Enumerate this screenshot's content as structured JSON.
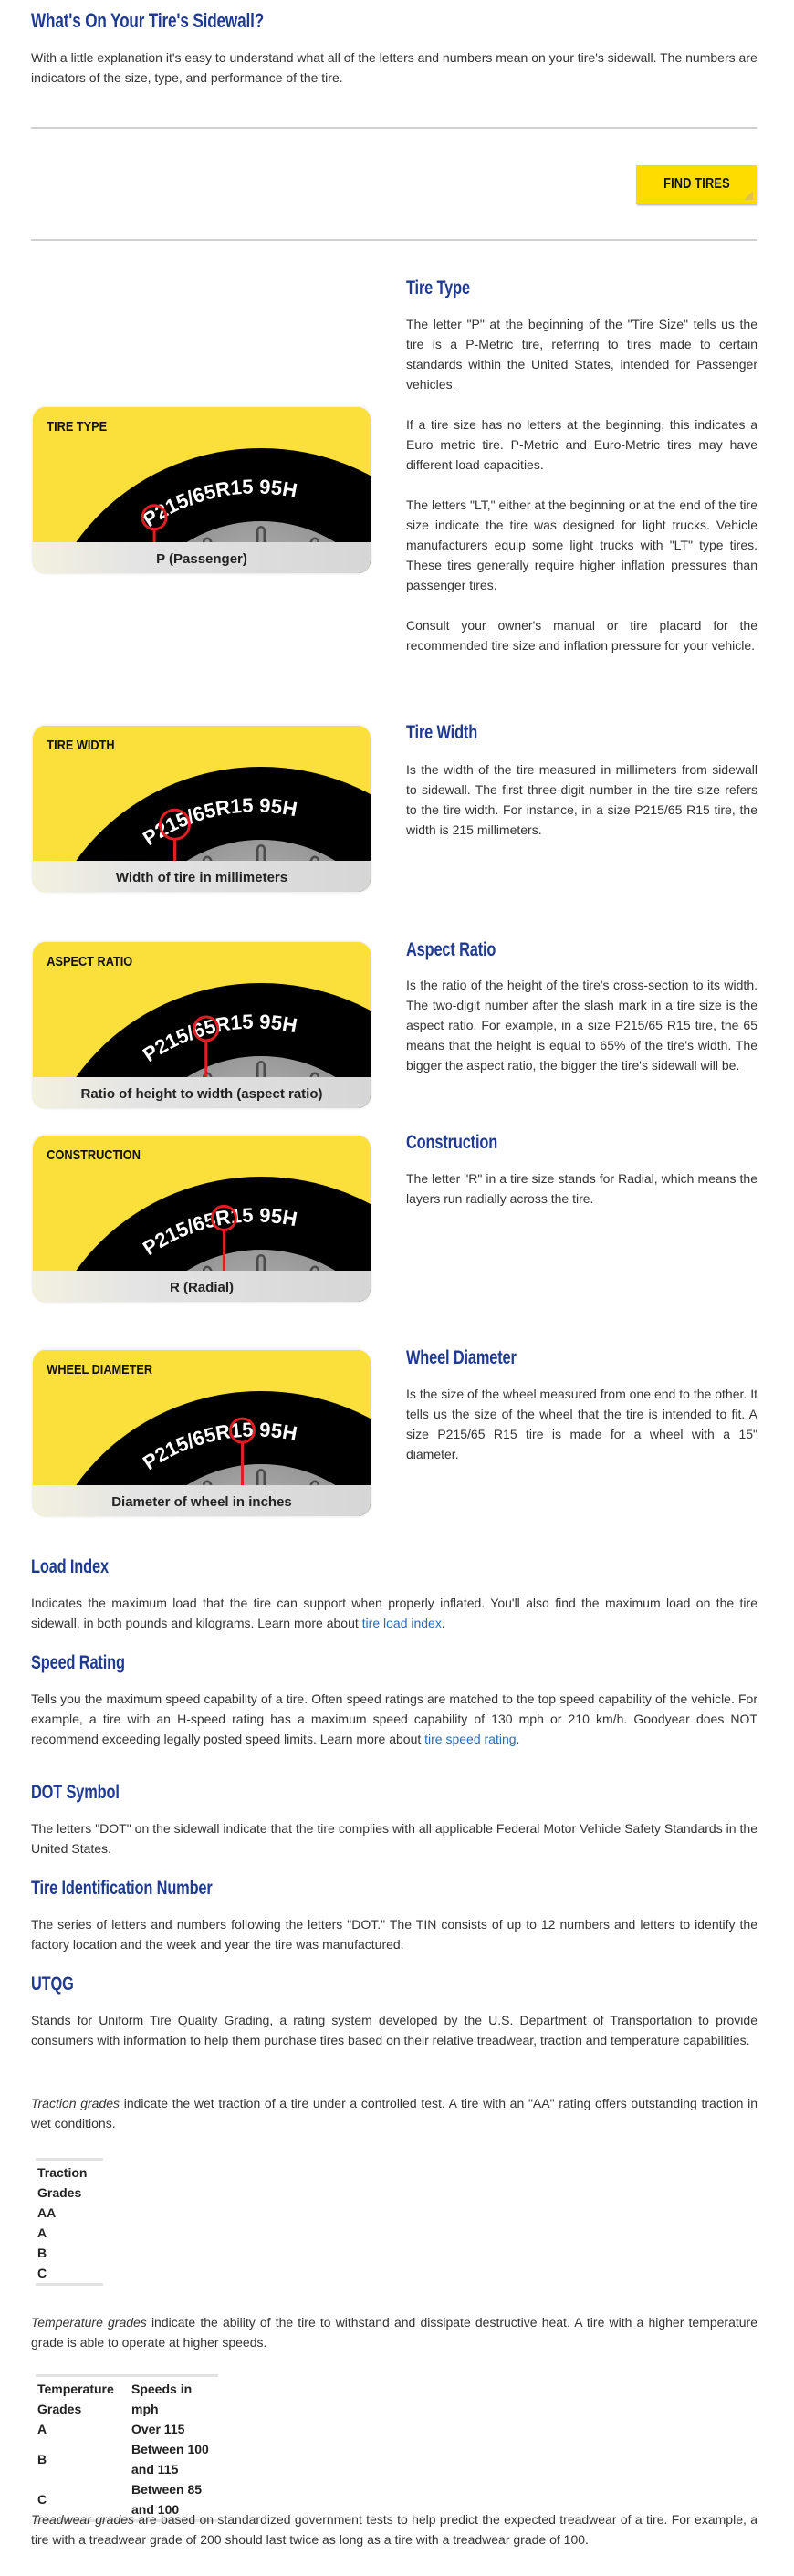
{
  "page": {
    "title": "What's On Your Tire's Sidewall?",
    "intro": "With a little explanation it's easy to understand what all of the letters and numbers mean on your tire's sidewall. The numbers are indicators of the size, type, and performance of the tire.",
    "find_tires_label": "FIND TIRES"
  },
  "tire_code": "P215/65R15 95H",
  "colors": {
    "heading": "#1f3a93",
    "link": "#2a6bb5",
    "accent_yellow": "#ffdc00",
    "highlight_red": "#e01e24"
  },
  "features": [
    {
      "title": "Tire Type",
      "image_label": "TIRE TYPE",
      "image_caption": "P (Passenger)",
      "highlight": "P",
      "paragraphs": [
        "The letter \"P\" at the beginning of the \"Tire Size\" tells us the tire is a P-Metric tire, referring to tires made to certain standards within the United States, intended for Passenger vehicles.",
        "If a tire size has no letters at the beginning, this indicates a Euro metric tire. P-Metric and Euro-Metric tires may have different load capacities.",
        "The letters \"LT,\" either at the beginning or at the end of the tire size indicate the tire was designed for light trucks. Vehicle manufacturers equip some light trucks with \"LT\" type tires. These tires generally require higher inflation pressures than passenger tires.",
        "Consult your owner's manual or tire placard for the recommended tire size and inflation pressure for your vehicle."
      ]
    },
    {
      "title": "Tire Width",
      "image_label": "TIRE WIDTH",
      "image_caption": "Width of tire in millimeters",
      "highlight": "215",
      "paragraphs": [
        "Is the width of the tire measured in millimeters from sidewall to sidewall. The first three-digit number in the tire size refers to the tire width. For instance, in a size P215/65 R15 tire, the width is 215 millimeters."
      ]
    },
    {
      "title": "Aspect Ratio",
      "image_label": "ASPECT RATIO",
      "image_caption": "Ratio of height to width (aspect ratio)",
      "highlight": "65",
      "paragraphs": [
        "Is the ratio of the height of the tire's cross-section to its width. The two-digit number after the slash mark in a tire size is the aspect ratio. For example, in a size P215/65 R15 tire, the 65 means that the height is equal to 65% of the tire's width. The bigger the aspect ratio, the bigger the tire's sidewall will be."
      ]
    },
    {
      "title": "Construction",
      "image_label": "CONSTRUCTION",
      "image_caption": "R (Radial)",
      "highlight": "R",
      "paragraphs": [
        "The letter \"R\" in a tire size stands for Radial, which means the layers run radially across the tire."
      ]
    },
    {
      "title": "Wheel Diameter",
      "image_label": "WHEEL DIAMETER",
      "image_caption": "Diameter of wheel in inches",
      "highlight": "15",
      "paragraphs": [
        "Is the size of the wheel measured from one end to the other. It tells us the size of the wheel that the tire is intended to fit. A size P215/65 R15 tire is made for a wheel with a 15\" diameter."
      ]
    }
  ],
  "sections": {
    "load_index": {
      "title": "Load Index",
      "text": "Indicates the maximum load that the tire can support when properly inflated. You'll also find the maximum load on the tire sidewall, in both pounds and kilograms. Learn more about ",
      "link": "tire load index",
      "after": "."
    },
    "speed_rating": {
      "title": "Speed Rating",
      "text": "Tells you the maximum speed capability of a tire. Often speed ratings are matched to the top speed capability of the vehicle. For example, a tire with an H-speed rating has a maximum speed capability of 130 mph or 210 km/h. Goodyear does NOT recommend exceeding legally posted speed limits. Learn more about ",
      "link": "tire speed rating",
      "after": "."
    },
    "dot_symbol": {
      "title": "DOT Symbol",
      "text": "The letters \"DOT\" on the sidewall indicate that the tire complies with all applicable Federal Motor Vehicle Safety Standards in the United States."
    },
    "tin": {
      "title": "Tire Identification Number",
      "text": "The series of letters and numbers following the letters \"DOT.\" The TIN consists of up to 12 numbers and letters to identify the factory location and the week and year the tire was manufactured."
    },
    "utqg": {
      "title": "UTQG",
      "text": "Stands for Uniform Tire Quality Grading, a rating system developed by the U.S. Department of Transportation to provide consumers with information to help them purchase tires based on their relative treadwear, traction and temperature capabilities.",
      "traction_em": "Traction grades",
      "traction_text": " indicate the wet traction of a tire under a controlled test. A tire with an \"AA\" rating offers outstanding traction in wet conditions.",
      "temperature_em": "Temperature grades",
      "temperature_text": " indicate the ability of the tire to withstand and dissipate destructive heat. A tire with a higher temperature grade is able to operate at higher speeds.",
      "treadwear_em": "Treadwear grades",
      "treadwear_text": " are based on standardized government tests to help predict the expected treadwear of a tire. For example, a tire with a treadwear grade of 200 should last twice as long as a tire with a treadwear grade of 100."
    }
  },
  "traction_table": {
    "header": "Traction Grades",
    "rows": [
      "AA",
      "A",
      "B",
      "C"
    ]
  },
  "temperature_table": {
    "headers": [
      "Temperature Grades",
      "Speeds in mph"
    ],
    "rows": [
      [
        "A",
        "Over 115"
      ],
      [
        "B",
        "Between 100 and 115"
      ],
      [
        "C",
        "Between 85 and 100"
      ]
    ]
  }
}
